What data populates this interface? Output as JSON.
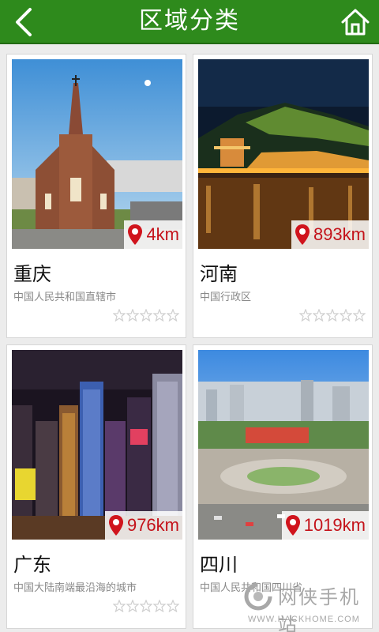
{
  "header": {
    "title": "区域分类",
    "back_icon": "chevron-left-icon",
    "home_icon": "home-icon",
    "bg_color": "#2e8a1c"
  },
  "regions": [
    {
      "name": "重庆",
      "desc": "中国人民共和国直辖市",
      "distance": "4km",
      "rating": 0
    },
    {
      "name": "河南",
      "desc": "中国行政区",
      "distance": "893km",
      "rating": 0
    },
    {
      "name": "广东",
      "desc": "中国大陆南端最沿海的城市",
      "distance": "976km",
      "rating": 0
    },
    {
      "name": "四川",
      "desc": "中国人民共和国四川省",
      "distance": "1019km",
      "rating": 0
    }
  ],
  "watermark": {
    "text": "网侠手机站",
    "url": "WWW.HACKHOME.COM"
  },
  "colors": {
    "distance_text": "#c4121a",
    "star_outline": "#cfcfcf"
  }
}
